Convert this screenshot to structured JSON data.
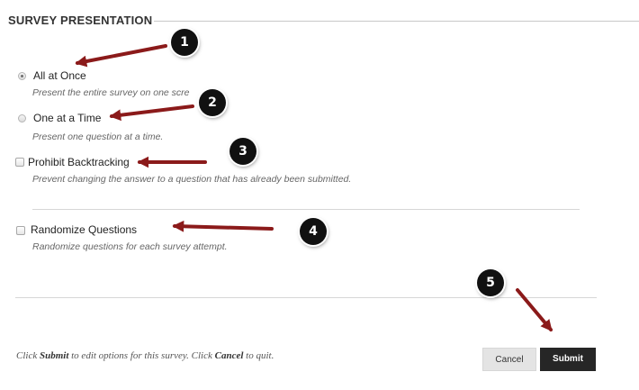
{
  "section": {
    "title": "SURVEY PRESENTATION"
  },
  "options": {
    "all_at_once": {
      "label": "All at Once",
      "hint": "Present the entire survey on one scre",
      "selected": true
    },
    "one_at_a_time": {
      "label": "One at a Time",
      "hint": "Present one question at a time.",
      "selected": false
    },
    "prohibit_backtracking": {
      "label": "Prohibit Backtracking",
      "hint": "Prevent changing the answer to a question that has already been submitted.",
      "checked": false
    },
    "randomize_questions": {
      "label": "Randomize Questions",
      "hint": "Randomize questions for each survey attempt.",
      "checked": false
    }
  },
  "footer": {
    "text_1": "Click ",
    "submit_word": "Submit",
    "text_2": " to edit options for this survey. Click ",
    "cancel_word": "Cancel",
    "text_3": " to quit."
  },
  "buttons": {
    "cancel": "Cancel",
    "submit": "Submit"
  },
  "callouts": [
    "1",
    "2",
    "3",
    "4",
    "5"
  ],
  "colors": {
    "arrow": "#8b1a1a",
    "callout_bg": "#111111",
    "submit_bg": "#262626"
  }
}
